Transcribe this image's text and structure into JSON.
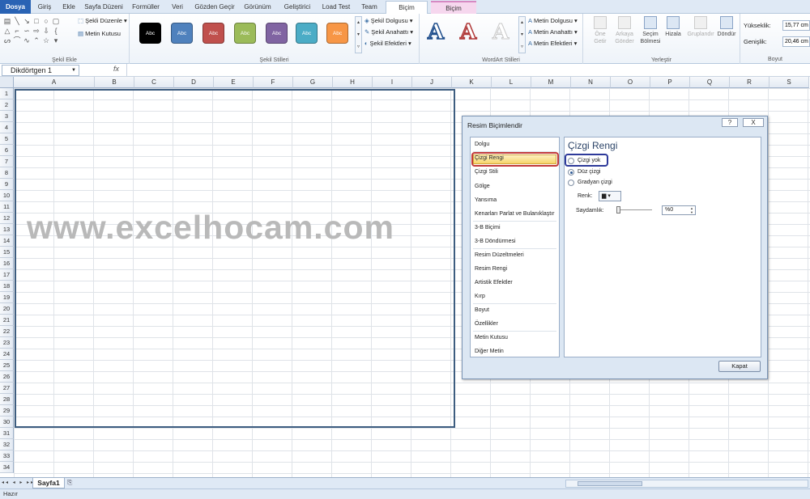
{
  "tabs": [
    "Dosya",
    "Giriş",
    "Ekle",
    "Sayfa Düzeni",
    "Formüller",
    "Veri",
    "Gözden Geçir",
    "Görünüm",
    "Geliştirici",
    "Load Test",
    "Team",
    "Biçim",
    "Biçim"
  ],
  "ribbon": {
    "insert_shapes": {
      "label": "Şekil Ekle",
      "edit_shape": "Şekli Düzenle",
      "text_box": "Metin Kutusu"
    },
    "shape_styles": {
      "label": "Şekil Stilleri",
      "sample_text": "Abc",
      "swatches": [
        "#000000",
        "#4f81bd",
        "#c0504d",
        "#9bbb59",
        "#8064a2",
        "#4bacc6",
        "#f79646"
      ],
      "fill": "Şekil Dolgusu",
      "outline": "Şekil Anahattı",
      "effects": "Şekil Efektleri"
    },
    "wordart": {
      "label": "WordArt Stilleri",
      "letter": "A",
      "text_fill": "Metin Dolgusu",
      "text_outline": "Metin Anahattı",
      "text_effects": "Metin Efektleri"
    },
    "arrange": {
      "label": "Yerleştir",
      "bring_forward": "Öne Getir",
      "send_backward": "Arkaya Gönder",
      "selection_pane": "Seçim Bölmesi",
      "align": "Hizala",
      "group": "Gruplandır",
      "rotate": "Döndür"
    },
    "size": {
      "label": "Boyut",
      "height_label": "Yükseklik:",
      "height_value": "15,77 cm",
      "width_label": "Genişlik:",
      "width_value": "20,46 cm"
    }
  },
  "formula_bar": {
    "name_box": "Dikdörtgen 1",
    "fx": "fx"
  },
  "columns": [
    "A",
    "B",
    "C",
    "D",
    "E",
    "F",
    "G",
    "H",
    "I",
    "J",
    "K",
    "L",
    "M",
    "N",
    "O",
    "P",
    "Q",
    "R",
    "S"
  ],
  "rows": [
    "1",
    "2",
    "3",
    "4",
    "5",
    "6",
    "7",
    "8",
    "9",
    "10",
    "11",
    "12",
    "13",
    "14",
    "15",
    "16",
    "17",
    "18",
    "19",
    "20",
    "21",
    "22",
    "23",
    "24",
    "25",
    "26",
    "27",
    "28",
    "29",
    "30",
    "31",
    "32",
    "33",
    "34"
  ],
  "watermark": "www.excelhocam.com",
  "sheet_tab": "Sayfa1",
  "status": "Hazır",
  "dialog": {
    "title": "Resim Biçimlendir",
    "help": "?",
    "close_x": "X",
    "categories": [
      "Dolgu",
      "Çizgi Rengi",
      "Çizgi Stili",
      "Gölge",
      "Yansıma",
      "Kenarları Parlat ve Bulanıklaştır",
      "3-B Biçimi",
      "3-B Döndürmesi",
      "Resim Düzeltmeleri",
      "Resim Rengi",
      "Artistik Efektler",
      "Kırp",
      "Boyut",
      "Özellikler",
      "Metin Kutusu",
      "Diğer Metin"
    ],
    "selected_category": "Çizgi Rengi",
    "panel_title": "Çizgi Rengi",
    "options": [
      "Çizgi yok",
      "Düz çizgi",
      "Gradyan çizgi"
    ],
    "selected_option": "Düz çizgi",
    "color_label": "Renk:",
    "transparency_label": "Saydamlık:",
    "transparency_value": "%0",
    "close_button": "Kapat"
  }
}
